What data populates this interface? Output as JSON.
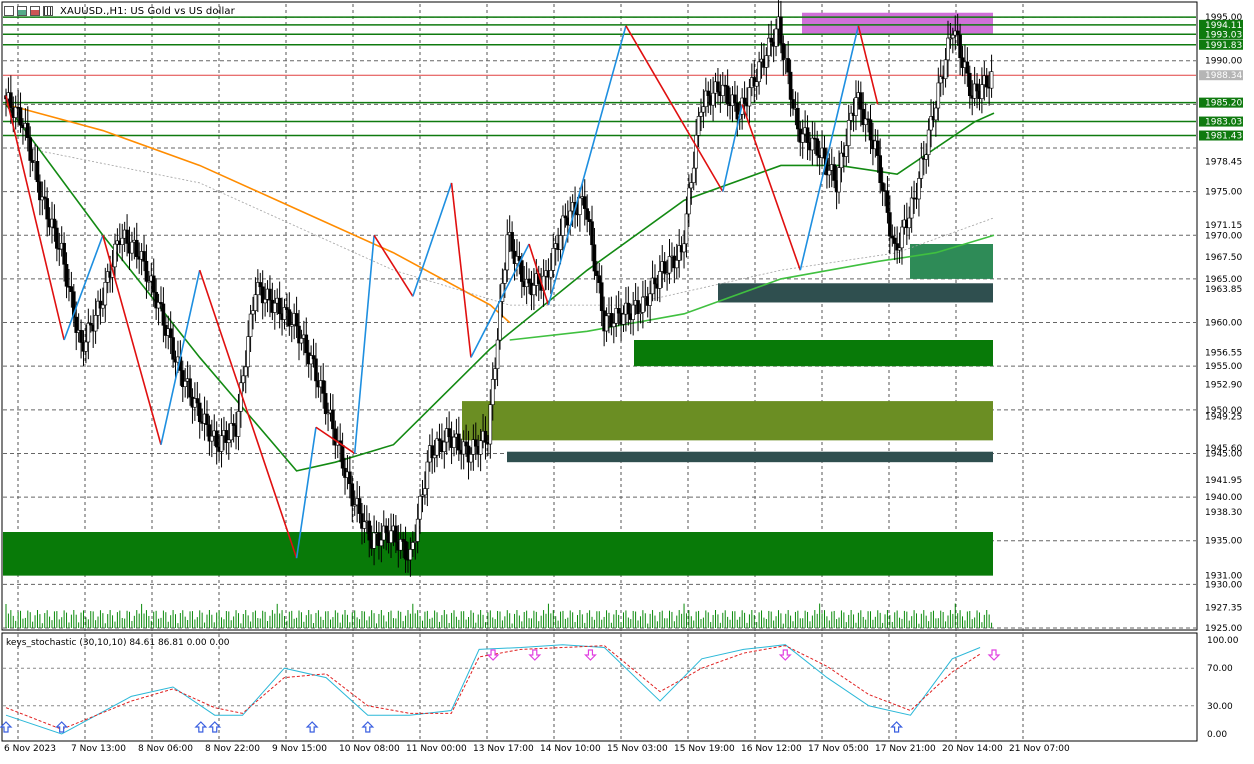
{
  "header": {
    "title": "XAUUSD.,H1:  US Gold vs US dollar",
    "icons": [
      "candles-icon",
      "bars-up-icon",
      "bars-down-icon",
      "bars-icon"
    ]
  },
  "price_axis": {
    "labels": [
      "1995.00",
      "1990.00",
      "1978.45",
      "1975.00",
      "1971.15",
      "1970.00",
      "1967.50",
      "1965.00",
      "1963.85",
      "1960.00",
      "1956.55",
      "1955.00",
      "1952.90",
      "1950.00",
      "1949.25",
      "1945.60",
      "1945.00",
      "1941.95",
      "1940.00",
      "1938.30",
      "1935.00",
      "1931.00",
      "1930.00",
      "1927.35",
      "1925.00"
    ],
    "highlight_labels": [
      {
        "text": "1994.11",
        "color": "#0f7a0f"
      },
      {
        "text": "1993.03",
        "color": "#0f7a0f"
      },
      {
        "text": "1991.83",
        "color": "#0f7a0f"
      },
      {
        "text": "1988.34",
        "color": "#b5b5b5"
      },
      {
        "text": "1985.20",
        "color": "#0f7a0f"
      },
      {
        "text": "1983.03",
        "color": "#0f7a0f"
      },
      {
        "text": "1981.43",
        "color": "#0f7a0f"
      }
    ]
  },
  "time_axis": {
    "labels": [
      "6 Nov 2023",
      "7 Nov 13:00",
      "8 Nov 06:00",
      "8 Nov 22:00",
      "9 Nov 15:00",
      "10 Nov 08:00",
      "11 Nov 00:00",
      "13 Nov 17:00",
      "14 Nov 10:00",
      "15 Nov 03:00",
      "15 Nov 19:00",
      "16 Nov 12:00",
      "17 Nov 05:00",
      "17 Nov 21:00",
      "20 Nov 14:00",
      "21 Nov 07:00"
    ]
  },
  "indicator": {
    "title": "keys_stochastic (30,10,10) 84.61 86.81 0.00 0.00",
    "axis_labels": [
      "100.00",
      "70.00",
      "30.00",
      "0.00"
    ],
    "main_color": "#2bb8d8",
    "signal_color": "#e02020",
    "up_arrow_color": "#3a5fe0",
    "down_arrow_color": "#e040e0"
  },
  "colors": {
    "bull_candle": "#000000",
    "bear_candle": "#000000",
    "zigzag_up": "#1e8fe0",
    "zigzag_down": "#e01010",
    "ma_fast": "#138a13",
    "ma_medium": "#40c040",
    "ma_slow": "#ff8c00",
    "ma_slowest": "#a0a0a0",
    "zone_green": "#087a08",
    "zone_olive": "#6b8e23",
    "zone_dark": "#2f4f4f",
    "zone_magenta": "#d070d8",
    "zone_seagreen": "#2e8b57",
    "level_line": "#0f7a0f",
    "bid_line": "#e04040"
  },
  "chart_data": {
    "type": "candlestick",
    "symbol": "XAUUSD.",
    "timeframe": "H1",
    "ylim": [
      1925.0,
      1996.5
    ],
    "x_labels": [
      "6 Nov 2023",
      "7 Nov 13:00",
      "8 Nov 06:00",
      "8 Nov 22:00",
      "9 Nov 15:00",
      "10 Nov 08:00",
      "11 Nov 00:00",
      "13 Nov 17:00",
      "14 Nov 10:00",
      "15 Nov 03:00",
      "15 Nov 19:00",
      "16 Nov 12:00",
      "17 Nov 05:00",
      "17 Nov 21:00",
      "20 Nov 14:00",
      "21 Nov 07:00"
    ],
    "price_path": [
      [
        0,
        1986
      ],
      [
        1,
        1983
      ],
      [
        2,
        1974
      ],
      [
        3,
        1968
      ],
      [
        4,
        1957
      ],
      [
        5,
        1962
      ],
      [
        6,
        1970
      ],
      [
        7,
        1968
      ],
      [
        8,
        1962
      ],
      [
        9,
        1955
      ],
      [
        10,
        1950
      ],
      [
        11,
        1946
      ],
      [
        12,
        1948
      ],
      [
        13,
        1964
      ],
      [
        14,
        1962
      ],
      [
        15,
        1960
      ],
      [
        16,
        1955
      ],
      [
        17,
        1948
      ],
      [
        18,
        1940
      ],
      [
        19,
        1935
      ],
      [
        20,
        1936
      ],
      [
        21,
        1933
      ],
      [
        22,
        1945
      ],
      [
        23,
        1947
      ],
      [
        24,
        1945
      ],
      [
        25,
        1947
      ],
      [
        26,
        1970
      ],
      [
        27,
        1964
      ],
      [
        28,
        1965
      ],
      [
        29,
        1972
      ],
      [
        30,
        1974
      ],
      [
        31,
        1960
      ],
      [
        32,
        1961
      ],
      [
        33,
        1962
      ],
      [
        34,
        1966
      ],
      [
        35,
        1968
      ],
      [
        36,
        1985
      ],
      [
        37,
        1987
      ],
      [
        38,
        1984
      ],
      [
        39,
        1989
      ],
      [
        40,
        1994
      ],
      [
        41,
        1982
      ],
      [
        42,
        1980
      ],
      [
        43,
        1976
      ],
      [
        44,
        1986
      ],
      [
        45,
        1980
      ],
      [
        46,
        1968
      ],
      [
        47,
        1974
      ],
      [
        48,
        1984
      ],
      [
        49,
        1994
      ],
      [
        50,
        1986
      ],
      [
        51,
        1988
      ]
    ],
    "zigzag": [
      [
        0,
        1986
      ],
      [
        3,
        1958
      ],
      [
        5,
        1970
      ],
      [
        8,
        1946
      ],
      [
        10,
        1966
      ],
      [
        15,
        1933
      ],
      [
        16,
        1948
      ],
      [
        18,
        1945
      ],
      [
        19,
        1970
      ],
      [
        21,
        1963
      ],
      [
        23,
        1976
      ],
      [
        24,
        1956
      ],
      [
        27,
        1969
      ],
      [
        28,
        1962
      ],
      [
        32,
        1994
      ],
      [
        37,
        1975
      ],
      [
        38,
        1985
      ],
      [
        41,
        1966
      ],
      [
        44,
        1994
      ],
      [
        45,
        1985
      ]
    ],
    "zones": [
      {
        "type": "demand",
        "y": [
          1931.0,
          1936.0
        ],
        "color": "#087a08"
      },
      {
        "type": "demand",
        "y": [
          1955.0,
          1958.0
        ],
        "color": "#087a08"
      },
      {
        "type": "demand",
        "y": [
          1946.5,
          1951.0
        ],
        "color": "#6b8e23"
      },
      {
        "type": "demand",
        "y": [
          1944.0,
          1945.2
        ],
        "color": "#2f4f4f"
      },
      {
        "type": "demand",
        "y": [
          1962.3,
          1964.5
        ],
        "color": "#2f4f4f"
      },
      {
        "type": "demand",
        "y": [
          1965.0,
          1969.0
        ],
        "color": "#2e8b57"
      },
      {
        "type": "supply",
        "y": [
          1993.0,
          1995.5
        ],
        "color": "#d070d8"
      }
    ],
    "levels": [
      1995.0,
      1994.11,
      1993.03,
      1991.83,
      1985.2,
      1983.03,
      1981.43
    ],
    "bid": 1988.34,
    "moving_averages": [
      {
        "path": [
          [
            0,
            1985
          ],
          [
            5,
            1970
          ],
          [
            10,
            1956
          ],
          [
            15,
            1943
          ],
          [
            17,
            1944
          ],
          [
            20,
            1946
          ],
          [
            25,
            1957
          ],
          [
            30,
            1966
          ],
          [
            35,
            1974
          ],
          [
            40,
            1978
          ],
          [
            43,
            1978
          ],
          [
            46,
            1977
          ],
          [
            50,
            1983
          ],
          [
            51,
            1984
          ]
        ],
        "color": "#138a13"
      },
      {
        "path": [
          [
            26,
            1958
          ],
          [
            30,
            1959
          ],
          [
            35,
            1961
          ],
          [
            40,
            1965
          ],
          [
            45,
            1967
          ],
          [
            48,
            1968
          ],
          [
            51,
            1970
          ]
        ],
        "color": "#40c040"
      },
      {
        "path": [
          [
            0,
            1985
          ],
          [
            5,
            1982
          ],
          [
            10,
            1978
          ],
          [
            15,
            1973
          ],
          [
            20,
            1968
          ],
          [
            25,
            1962
          ],
          [
            26,
            1960
          ]
        ],
        "color": "#ff8c00"
      },
      {
        "path": [
          [
            1,
            1980
          ],
          [
            10,
            1976
          ],
          [
            20,
            1966
          ],
          [
            26,
            1962
          ],
          [
            32,
            1962
          ],
          [
            40,
            1966
          ],
          [
            46,
            1968
          ],
          [
            51,
            1972
          ]
        ],
        "color": "#a0a0a0"
      }
    ],
    "stochastic": {
      "ylim": [
        0,
        100
      ],
      "main": [
        [
          0,
          20
        ],
        [
          4,
          0
        ],
        [
          9,
          40
        ],
        [
          12,
          50
        ],
        [
          15,
          20
        ],
        [
          17,
          20
        ],
        [
          20,
          70
        ],
        [
          23,
          60
        ],
        [
          26,
          20
        ],
        [
          29,
          20
        ],
        [
          32,
          25
        ],
        [
          34,
          90
        ],
        [
          37,
          92
        ],
        [
          40,
          95
        ],
        [
          43,
          92
        ],
        [
          47,
          35
        ],
        [
          50,
          80
        ],
        [
          53,
          90
        ],
        [
          56,
          95
        ],
        [
          59,
          60
        ],
        [
          62,
          30
        ],
        [
          65,
          20
        ],
        [
          68,
          80
        ],
        [
          70,
          92
        ]
      ],
      "signal": [
        [
          0,
          28
        ],
        [
          4,
          5
        ],
        [
          9,
          35
        ],
        [
          12,
          48
        ],
        [
          15,
          28
        ],
        [
          17,
          22
        ],
        [
          20,
          60
        ],
        [
          23,
          64
        ],
        [
          26,
          30
        ],
        [
          29,
          22
        ],
        [
          32,
          22
        ],
        [
          34,
          82
        ],
        [
          37,
          90
        ],
        [
          40,
          92
        ],
        [
          43,
          94
        ],
        [
          47,
          45
        ],
        [
          50,
          70
        ],
        [
          53,
          86
        ],
        [
          56,
          94
        ],
        [
          59,
          72
        ],
        [
          62,
          42
        ],
        [
          65,
          25
        ],
        [
          68,
          66
        ],
        [
          70,
          85
        ]
      ],
      "up_arrows": [
        0,
        4,
        14,
        15,
        22,
        26,
        64
      ],
      "down_arrows": [
        35,
        38,
        42,
        56,
        71
      ]
    }
  }
}
